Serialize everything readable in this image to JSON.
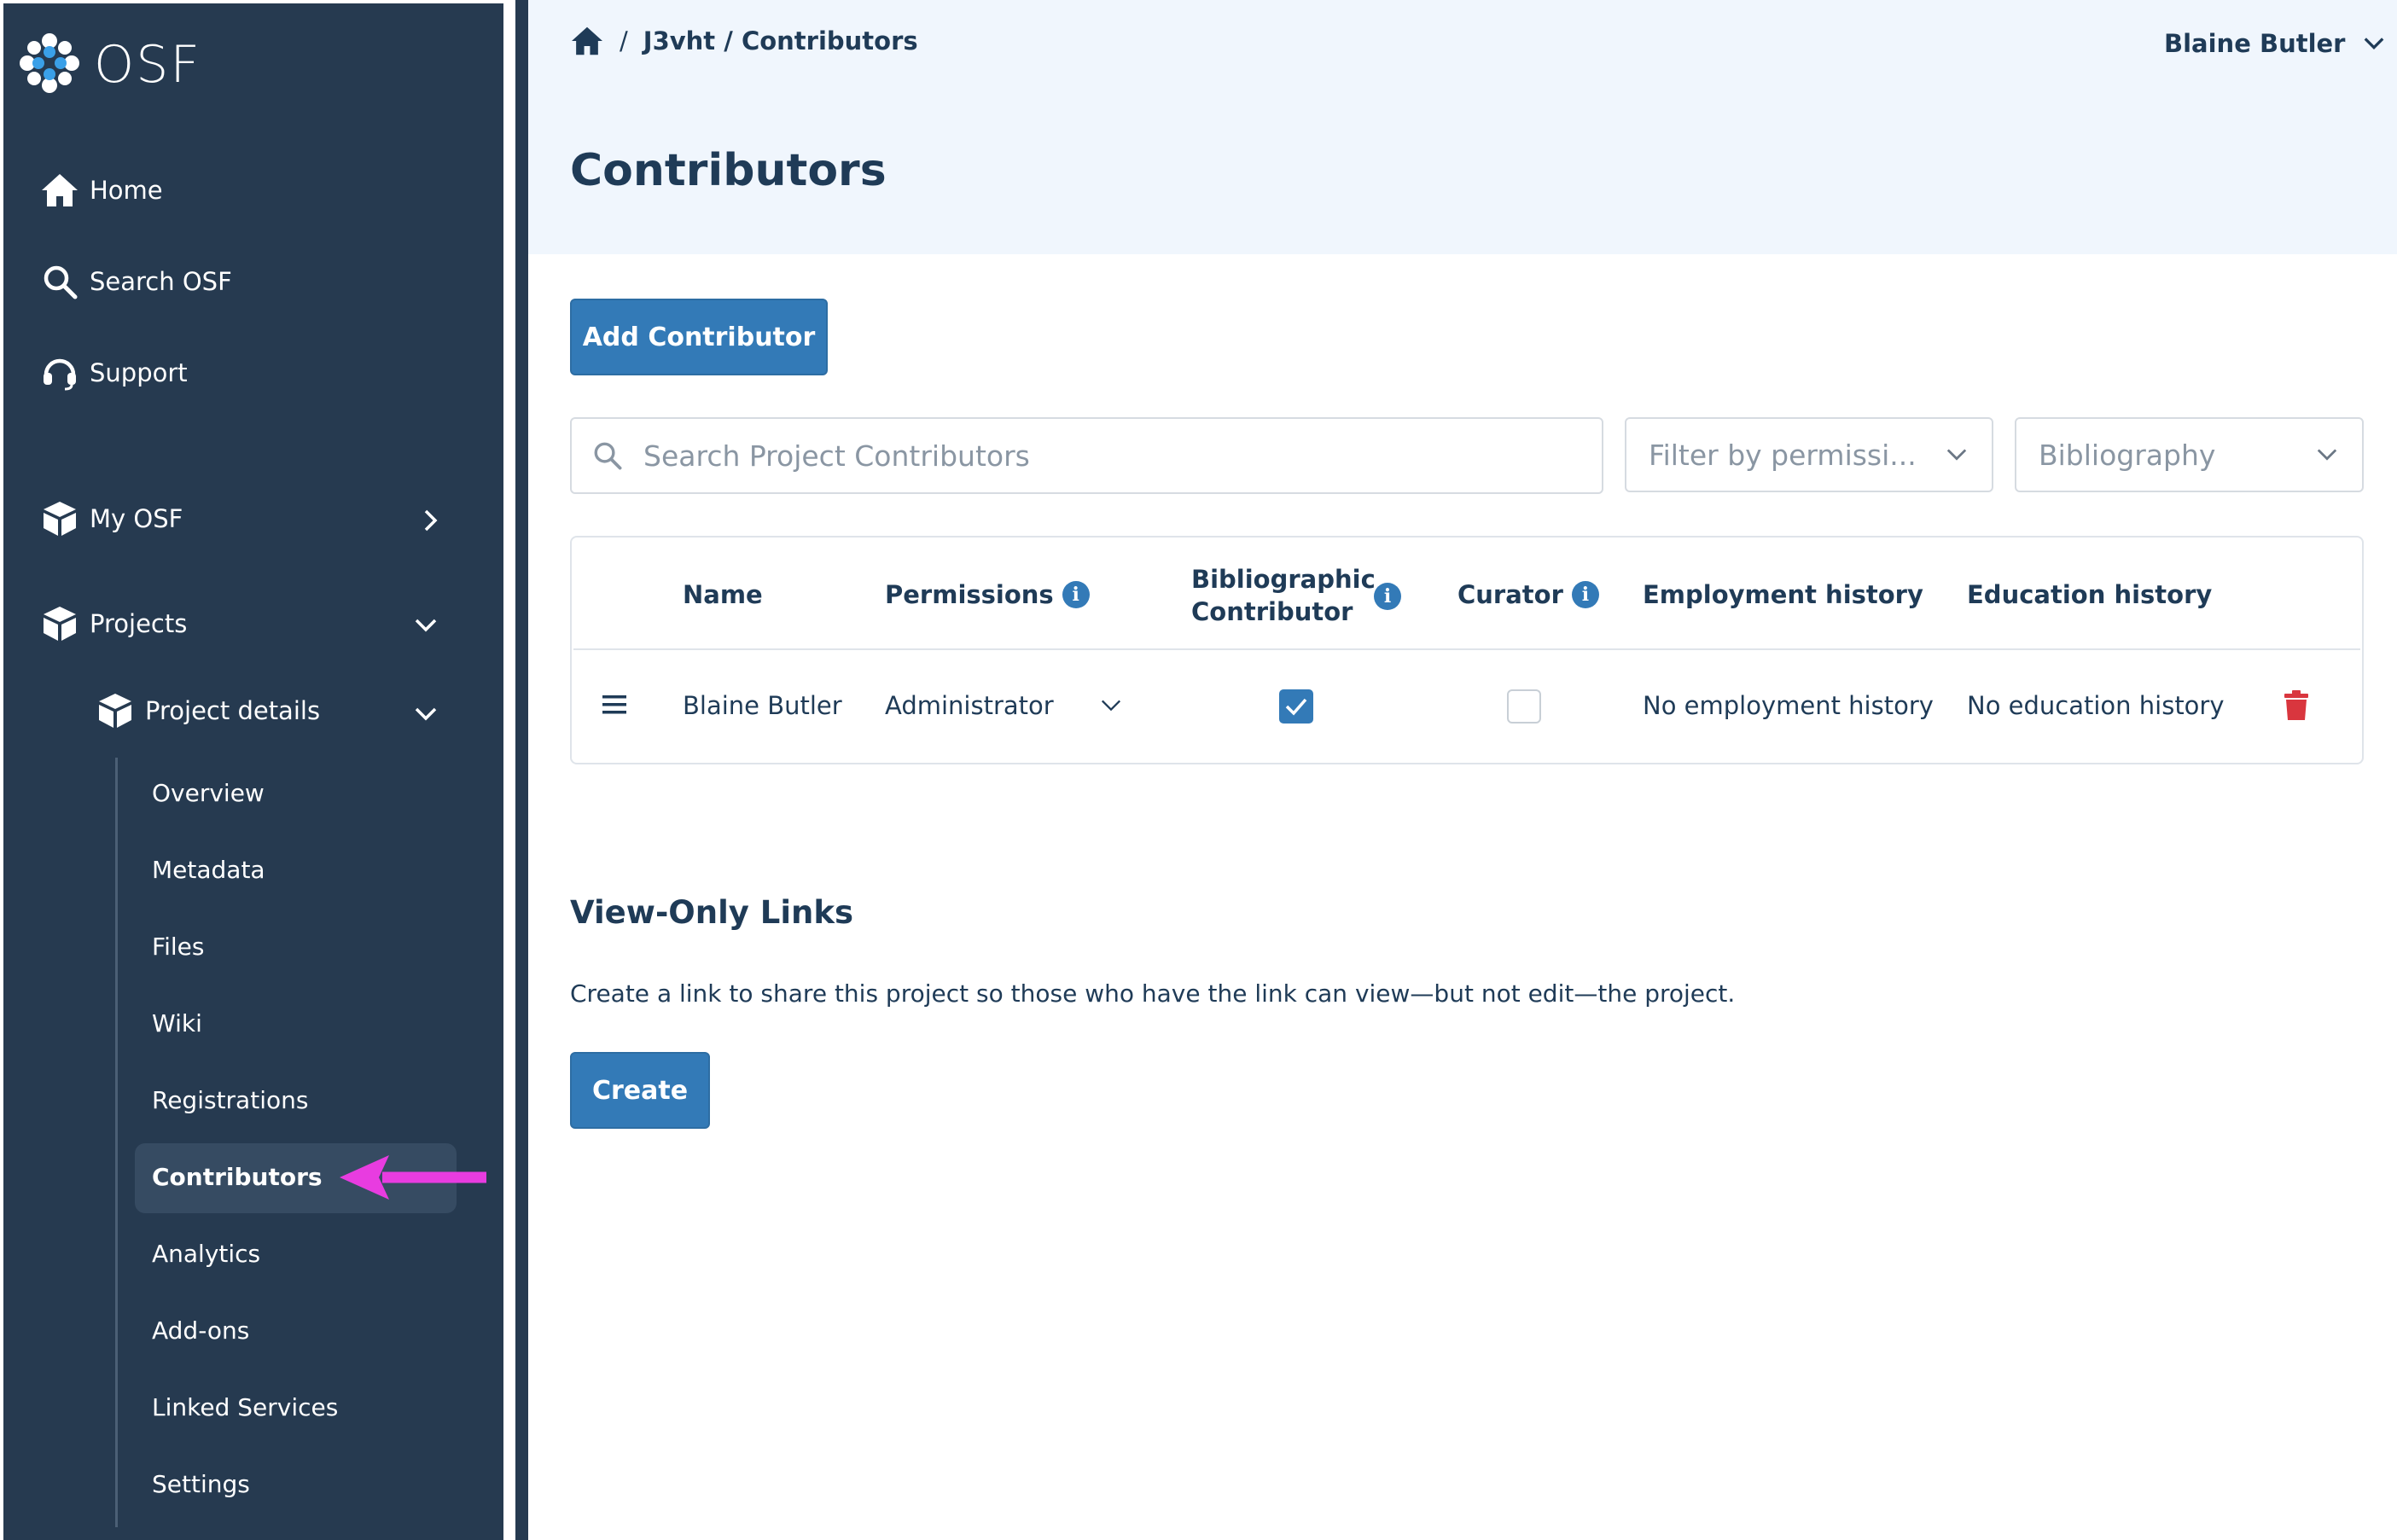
{
  "app": {
    "logo_text": "OSF"
  },
  "sidebar": {
    "home": "Home",
    "search": "Search OSF",
    "support": "Support",
    "my_osf": "My OSF",
    "projects": "Projects",
    "project_details": "Project details",
    "items": [
      {
        "label": "Overview"
      },
      {
        "label": "Metadata"
      },
      {
        "label": "Files"
      },
      {
        "label": "Wiki"
      },
      {
        "label": "Registrations"
      },
      {
        "label": "Contributors",
        "active": true
      },
      {
        "label": "Analytics"
      },
      {
        "label": "Add-ons"
      },
      {
        "label": "Linked Services"
      },
      {
        "label": "Settings"
      }
    ]
  },
  "header": {
    "breadcrumb": "J3vht / Contributors",
    "separator": "/",
    "user_name": "Blaine Butler",
    "page_title": "Contributors"
  },
  "toolbar": {
    "add_contributor": "Add Contributor",
    "search_placeholder": "Search Project Contributors",
    "filter_placeholder": "Filter by permissi...",
    "bibliography_placeholder": "Bibliography"
  },
  "table": {
    "columns": {
      "name": "Name",
      "permissions": "Permissions",
      "bibliographic_line1": "Bibliographic",
      "bibliographic_line2": "Contributor",
      "curator": "Curator",
      "employment": "Employment history",
      "education": "Education history"
    },
    "rows": [
      {
        "name": "Blaine Butler",
        "permission": "Administrator",
        "bibliographic": true,
        "curator": false,
        "employment": "No employment history",
        "education": "No education history"
      }
    ]
  },
  "view_only": {
    "title": "View-Only Links",
    "description": "Create a link to share this project so those who have the link can view—but not edit—the project.",
    "create_label": "Create"
  },
  "colors": {
    "sidebar_bg": "#263a50",
    "primary": "#337ab7",
    "header_band": "#f0f6fd",
    "danger": "#d9363e",
    "annotation_arrow": "#e83ce0"
  },
  "icons": [
    "osf-logo-icon",
    "home-icon",
    "search-icon",
    "headset-icon",
    "cube-icon",
    "chevron-right-icon",
    "chevron-down-icon",
    "info-icon",
    "drag-handle-icon",
    "trash-icon",
    "checkbox-icon"
  ]
}
